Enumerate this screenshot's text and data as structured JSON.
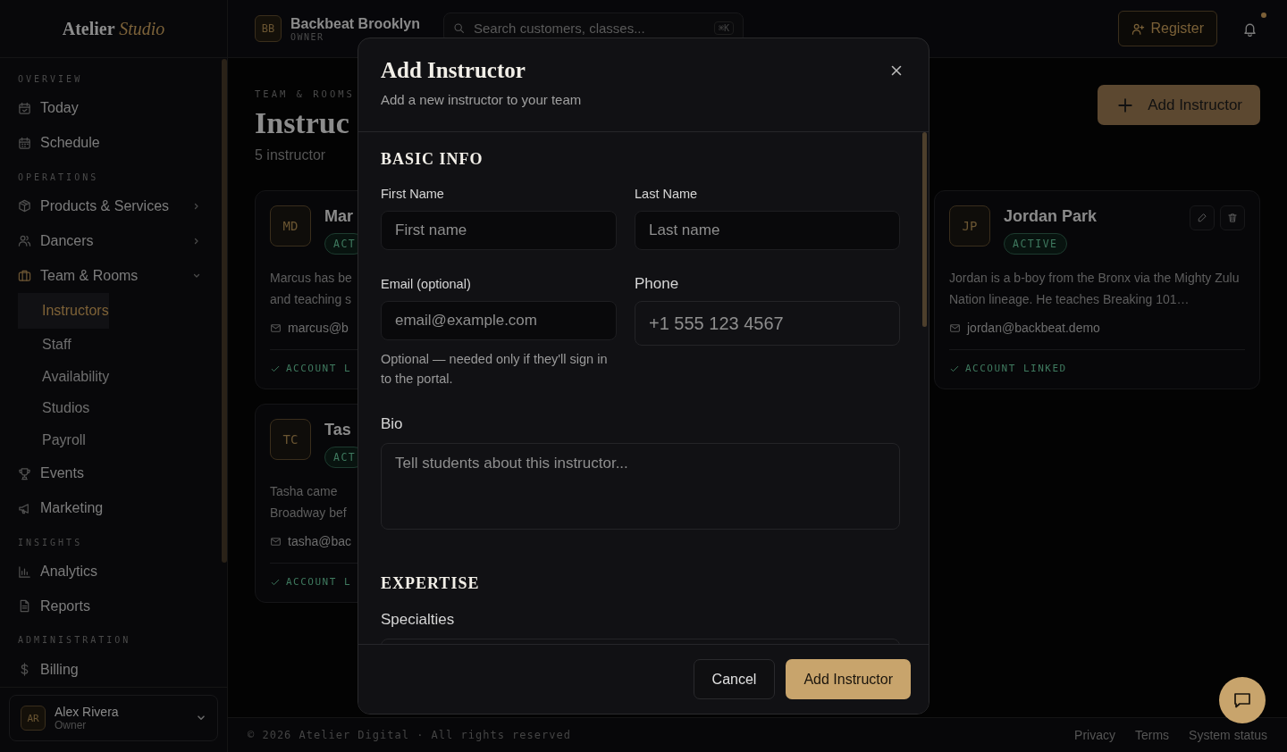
{
  "sidebar": {
    "logo": {
      "main": "Atelier",
      "accent": "Studio"
    },
    "sections": [
      {
        "title": "OVERVIEW",
        "items": [
          {
            "label": "Today"
          },
          {
            "label": "Schedule"
          }
        ]
      },
      {
        "title": "OPERATIONS",
        "items": [
          {
            "label": "Products & Services",
            "expandable": true,
            "expanded": false
          },
          {
            "label": "Dancers",
            "expandable": true,
            "expanded": false
          },
          {
            "label": "Team & Rooms",
            "expandable": true,
            "expanded": true,
            "children": [
              {
                "label": "Instructors",
                "selected": true
              },
              {
                "label": "Staff",
                "selected": false
              },
              {
                "label": "Availability",
                "selected": false
              },
              {
                "label": "Studios",
                "selected": false
              },
              {
                "label": "Payroll",
                "selected": false
              }
            ]
          },
          {
            "label": "Events"
          },
          {
            "label": "Marketing"
          }
        ]
      },
      {
        "title": "INSIGHTS",
        "items": [
          {
            "label": "Analytics"
          },
          {
            "label": "Reports"
          }
        ]
      },
      {
        "title": "ADMINISTRATION",
        "items": [
          {
            "label": "Billing"
          }
        ]
      }
    ],
    "user": {
      "initials": "AR",
      "name": "Alex Rivera",
      "role": "Owner"
    }
  },
  "topbar": {
    "workspace": {
      "initials": "BB",
      "name": "Backbeat Brooklyn",
      "role": "OWNER"
    },
    "search": {
      "placeholder": "Search customers, classes...",
      "shortcut": "⌘K"
    },
    "register_button": "Register",
    "notifications": {
      "unread": true
    }
  },
  "page": {
    "eyebrow": "TEAM & ROOMS",
    "title": "Instruc",
    "subtitle": "5 instructor",
    "add_button": "Add Instructor"
  },
  "card_columns": [
    [
      {
        "initials": "MD",
        "name": "Mar",
        "status": "ACT",
        "bio": "Marcus has be\nand teaching s",
        "email": "marcus@b",
        "account": "ACCOUNT L",
        "linked": true
      },
      {
        "initials": "TC",
        "name": "Tas",
        "status": "ACT",
        "bio": "Tasha came\nBroadway bef",
        "email": "tasha@bac",
        "account": "ACCOUNT L",
        "linked": true
      }
    ],
    [
      {
        "initials": "JP",
        "name": "Jordan Park",
        "status": "ACTIVE",
        "bio": "Jordan is a b-boy from the Bronx via the Mighty Zulu Nation lineage. He teaches Breaking 101…",
        "email": "jordan@backbeat.demo",
        "account": "ACCOUNT LINKED",
        "linked": true,
        "actions": true
      }
    ]
  ],
  "modal": {
    "title": "Add Instructor",
    "subtitle": "Add a new instructor to your team",
    "sections": [
      {
        "heading": "BASIC INFO",
        "fields": [
          {
            "kind": "text",
            "label": "First Name",
            "placeholder": "First name"
          },
          {
            "kind": "text",
            "label": "Last Name",
            "placeholder": "Last name"
          },
          {
            "kind": "text",
            "label": "Email (optional)",
            "placeholder": "email@example.com",
            "hint": "Optional — needed only if they'll sign in to the portal."
          },
          {
            "kind": "tel",
            "label": "Phone",
            "placeholder": "+1 555 123 4567"
          },
          {
            "kind": "textarea",
            "label": "Bio",
            "placeholder": "Tell students about this instructor..."
          }
        ]
      },
      {
        "heading": "EXPERTISE",
        "fields": [
          {
            "kind": "select",
            "label": "Specialties"
          }
        ]
      }
    ],
    "buttons": {
      "cancel": "Cancel",
      "submit": "Add Instructor"
    }
  },
  "footer": {
    "copyright": "© 2026 Atelier Digital · All rights reserved",
    "links": [
      "Privacy",
      "Terms",
      "System status"
    ]
  }
}
